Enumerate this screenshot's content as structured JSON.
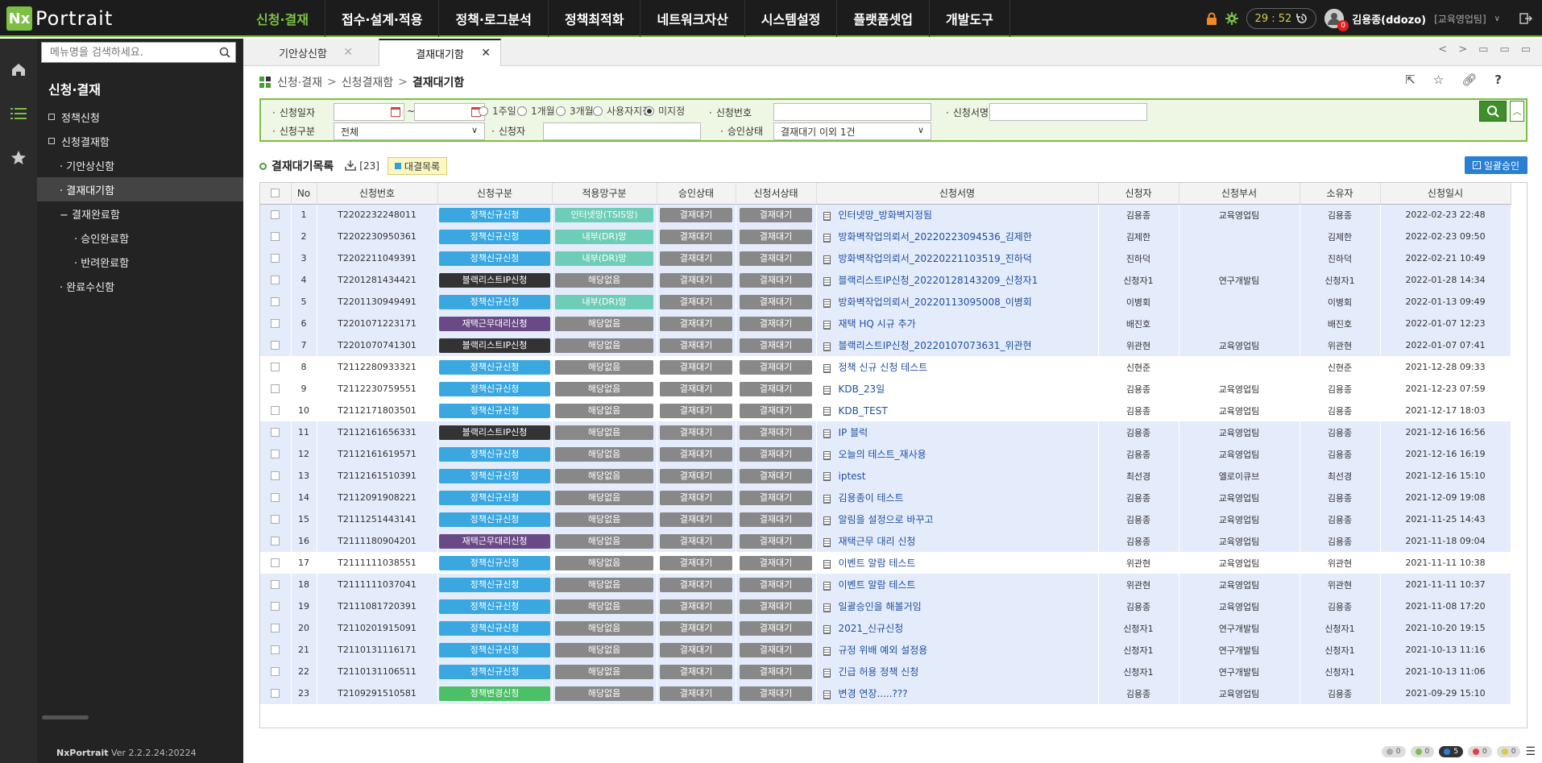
{
  "app": {
    "logo_mark": "Nx",
    "logo_text": "Portrait"
  },
  "nav": [
    {
      "label": "신청·결재",
      "active": true
    },
    {
      "label": "접수·설계·적용"
    },
    {
      "label": "정책·로그분석"
    },
    {
      "label": "정책최적화"
    },
    {
      "label": "네트워크자산"
    },
    {
      "label": "시스템설정"
    },
    {
      "label": "플랫폼셋업"
    },
    {
      "label": "개발도구"
    }
  ],
  "topright": {
    "timer": "29 : 52",
    "notif_count": "0",
    "user": "김용종(ddozo)",
    "dept": "[교육영업팀]"
  },
  "sidebar": {
    "search_placeholder": "메뉴명을 검색하세요.",
    "title": "신청·결재",
    "items": [
      {
        "label": "정책신청",
        "level": 1
      },
      {
        "label": "신청결재함",
        "level": 1
      },
      {
        "label": "· 기안상신함",
        "level": 2
      },
      {
        "label": "· 결재대기함",
        "level": 2,
        "active": true
      },
      {
        "label": "−  결재완료함",
        "level": 2
      },
      {
        "label": "· 승인완료함",
        "level": 3
      },
      {
        "label": "· 반려완료함",
        "level": 3
      },
      {
        "label": "· 완료수신함",
        "level": 2
      }
    ],
    "version_brand": "NxPortrait",
    "version": "Ver 2.2.2.24:20224"
  },
  "tabs": [
    {
      "label": "기안상신함"
    },
    {
      "label": "결재대기함",
      "active": true
    }
  ],
  "breadcrumb": {
    "root": "신청·결재",
    "mid": "신청결재함",
    "current": "결재대기함"
  },
  "filter": {
    "date_label": "신청일자",
    "date_sep": "~",
    "period_options": [
      "1주일",
      "1개월",
      "3개월",
      "사용자지정",
      "미지정"
    ],
    "period_selected": 4,
    "reqno_label": "신청번호",
    "docname_label": "신청서명",
    "type_label": "신청구분",
    "type_value": "전체",
    "requester_label": "신청자",
    "status_label": "승인상태",
    "status_value": "결재대기 이외 1건"
  },
  "list": {
    "title": "결재대기목록",
    "count": "[23]",
    "delegate_label": "대결목록",
    "bulk_label": "일괄승인"
  },
  "table": {
    "headers": [
      "No",
      "신청번호",
      "신청구분",
      "적용망구분",
      "승인상태",
      "신청서상태",
      "신청서명",
      "신청자",
      "신청부서",
      "소유자",
      "신청일시"
    ],
    "rows": [
      {
        "no": "1",
        "reqno": "T2202232248011",
        "type": "정책신규신청",
        "tc": "blue",
        "net": "인터넷망(TSIS망)",
        "nc": "teal",
        "ap": "결재대기",
        "st": "결재대기",
        "name": "인터넷망_방화벽지정됨",
        "req": "김용종",
        "dept": "교육영업팀",
        "owner": "김용종",
        "date": "2022-02-23 22:48",
        "hl": true
      },
      {
        "no": "2",
        "reqno": "T2202230950361",
        "type": "정책신규신청",
        "tc": "blue",
        "net": "내부(DR)망",
        "nc": "teal",
        "ap": "결재대기",
        "st": "결재대기",
        "name": "방화벽작업의뢰서_20220223094536_김제한",
        "req": "김제한",
        "dept": "",
        "owner": "김제한",
        "date": "2022-02-23 09:50",
        "hl": true
      },
      {
        "no": "3",
        "reqno": "T2202211049391",
        "type": "정책신규신청",
        "tc": "blue",
        "net": "내부(DR)망",
        "nc": "teal",
        "ap": "결재대기",
        "st": "결재대기",
        "name": "방화벽작업의뢰서_20220221103519_진하덕",
        "req": "진하덕",
        "dept": "",
        "owner": "진하덕",
        "date": "2022-02-21 10:49",
        "hl": true
      },
      {
        "no": "4",
        "reqno": "T2201281434421",
        "type": "블랙리스트IP신청",
        "tc": "dark",
        "net": "해당없음",
        "nc": "gray",
        "ap": "결재대기",
        "st": "결재대기",
        "name": "블랙리스트IP신청_20220128143209_신청자1",
        "req": "신청자1",
        "dept": "연구개발팀",
        "owner": "신청자1",
        "date": "2022-01-28 14:34",
        "hl": true
      },
      {
        "no": "5",
        "reqno": "T2201130949491",
        "type": "정책신규신청",
        "tc": "blue",
        "net": "내부(DR)망",
        "nc": "teal",
        "ap": "결재대기",
        "st": "결재대기",
        "name": "방화벽작업의뢰서_20220113095008_이병회",
        "req": "이병회",
        "dept": "",
        "owner": "이병회",
        "date": "2022-01-13 09:49",
        "hl": true
      },
      {
        "no": "6",
        "reqno": "T2201071223171",
        "type": "재택근무대리신청",
        "tc": "purple",
        "net": "해당없음",
        "nc": "gray",
        "ap": "결재대기",
        "st": "결재대기",
        "name": "재택 HQ 시규 추가",
        "req": "배진호",
        "dept": "",
        "owner": "배진호",
        "date": "2022-01-07 12:23",
        "hl": true
      },
      {
        "no": "7",
        "reqno": "T2201070741301",
        "type": "블랙리스트IP신청",
        "tc": "dark",
        "net": "해당없음",
        "nc": "gray",
        "ap": "결재대기",
        "st": "결재대기",
        "name": "블랙리스트IP신청_20220107073631_위관현",
        "req": "위관현",
        "dept": "교육영업팀",
        "owner": "위관현",
        "date": "2022-01-07 07:41",
        "hl": true
      },
      {
        "no": "8",
        "reqno": "T2112280933321",
        "type": "정책신규신청",
        "tc": "blue",
        "net": "해당없음",
        "nc": "gray",
        "ap": "결재대기",
        "st": "결재대기",
        "name": "정책 신규 신청 테스트",
        "req": "신현준",
        "dept": "",
        "owner": "신현준",
        "date": "2021-12-28 09:33",
        "hl": false
      },
      {
        "no": "9",
        "reqno": "T2112230759551",
        "type": "정책신규신청",
        "tc": "blue",
        "net": "해당없음",
        "nc": "gray",
        "ap": "결재대기",
        "st": "결재대기",
        "name": "KDB_23일",
        "req": "김용종",
        "dept": "교육영업팀",
        "owner": "김용종",
        "date": "2021-12-23 07:59",
        "hl": false
      },
      {
        "no": "10",
        "reqno": "T2112171803501",
        "type": "정책신규신청",
        "tc": "blue",
        "net": "해당없음",
        "nc": "gray",
        "ap": "결재대기",
        "st": "결재대기",
        "name": "KDB_TEST",
        "req": "김용종",
        "dept": "교육영업팀",
        "owner": "김용종",
        "date": "2021-12-17 18:03",
        "hl": false
      },
      {
        "no": "11",
        "reqno": "T2112161656331",
        "type": "블랙리스트IP신청",
        "tc": "dark",
        "net": "해당없음",
        "nc": "gray",
        "ap": "결재대기",
        "st": "결재대기",
        "name": "IP 블럭",
        "req": "김용종",
        "dept": "교육영업팀",
        "owner": "김용종",
        "date": "2021-12-16 16:56",
        "hl": true
      },
      {
        "no": "12",
        "reqno": "T2112161619571",
        "type": "정책신규신청",
        "tc": "blue",
        "net": "해당없음",
        "nc": "gray",
        "ap": "결재대기",
        "st": "결재대기",
        "name": "오늘의 테스트_재사용",
        "req": "김용종",
        "dept": "교육영업팀",
        "owner": "김용종",
        "date": "2021-12-16 16:19",
        "hl": true
      },
      {
        "no": "13",
        "reqno": "T2112161510391",
        "type": "정책신규신청",
        "tc": "blue",
        "net": "해당없음",
        "nc": "gray",
        "ap": "결재대기",
        "st": "결재대기",
        "name": "iptest",
        "req": "최선경",
        "dept": "엘로이큐브",
        "owner": "최선경",
        "date": "2021-12-16 15:10",
        "hl": true
      },
      {
        "no": "14",
        "reqno": "T2112091908221",
        "type": "정책신규신청",
        "tc": "blue",
        "net": "해당없음",
        "nc": "gray",
        "ap": "결재대기",
        "st": "결재대기",
        "name": "김용종이 테스트",
        "req": "김용종",
        "dept": "교육영업팀",
        "owner": "김용종",
        "date": "2021-12-09 19:08",
        "hl": true
      },
      {
        "no": "15",
        "reqno": "T2111251443141",
        "type": "정책신규신청",
        "tc": "blue",
        "net": "해당없음",
        "nc": "gray",
        "ap": "결재대기",
        "st": "결재대기",
        "name": "알림을 설정으로 바꾸고",
        "req": "김용종",
        "dept": "교육영업팀",
        "owner": "김용종",
        "date": "2021-11-25 14:43",
        "hl": true
      },
      {
        "no": "16",
        "reqno": "T2111180904201",
        "type": "재택근무대리신청",
        "tc": "purple",
        "net": "해당없음",
        "nc": "gray",
        "ap": "결재대기",
        "st": "결재대기",
        "name": "재택근무 대리 신청",
        "req": "김용종",
        "dept": "교육영업팀",
        "owner": "김용종",
        "date": "2021-11-18 09:04",
        "hl": true
      },
      {
        "no": "17",
        "reqno": "T2111111038551",
        "type": "정책신규신청",
        "tc": "blue",
        "net": "해당없음",
        "nc": "gray",
        "ap": "결재대기",
        "st": "결재대기",
        "name": "이벤트 알람 테스트",
        "req": "위관현",
        "dept": "교육영업팀",
        "owner": "위관현",
        "date": "2021-11-11 10:38",
        "hl": false
      },
      {
        "no": "18",
        "reqno": "T2111111037041",
        "type": "정책신규신청",
        "tc": "blue",
        "net": "해당없음",
        "nc": "gray",
        "ap": "결재대기",
        "st": "결재대기",
        "name": "이벤트 알람 테스트",
        "req": "위관현",
        "dept": "교육영업팀",
        "owner": "위관현",
        "date": "2021-11-11 10:37",
        "hl": true
      },
      {
        "no": "19",
        "reqno": "T2111081720391",
        "type": "정책신규신청",
        "tc": "blue",
        "net": "해당없음",
        "nc": "gray",
        "ap": "결재대기",
        "st": "결재대기",
        "name": "일괄승인을 해볼거임",
        "req": "김용종",
        "dept": "교육영업팀",
        "owner": "김용종",
        "date": "2021-11-08 17:20",
        "hl": true
      },
      {
        "no": "20",
        "reqno": "T2110201915091",
        "type": "정책신규신청",
        "tc": "blue",
        "net": "해당없음",
        "nc": "gray",
        "ap": "결재대기",
        "st": "결재대기",
        "name": "2021_신규신청",
        "req": "신청자1",
        "dept": "연구개발팀",
        "owner": "신청자1",
        "date": "2021-10-20 19:15",
        "hl": true
      },
      {
        "no": "21",
        "reqno": "T2110131116171",
        "type": "정책신규신청",
        "tc": "blue",
        "net": "해당없음",
        "nc": "gray",
        "ap": "결재대기",
        "st": "결재대기",
        "name": "규정 위배 예외 설정용",
        "req": "신청자1",
        "dept": "연구개발팀",
        "owner": "신청자1",
        "date": "2021-10-13 11:16",
        "hl": true
      },
      {
        "no": "22",
        "reqno": "T2110131106511",
        "type": "정책신규신청",
        "tc": "blue",
        "net": "해당없음",
        "nc": "gray",
        "ap": "결재대기",
        "st": "결재대기",
        "name": "긴급 허용 정책 신청",
        "req": "신청자1",
        "dept": "연구개발팀",
        "owner": "신청자1",
        "date": "2021-10-13 11:06",
        "hl": true
      },
      {
        "no": "23",
        "reqno": "T2109291510581",
        "type": "정책변경신청",
        "tc": "green",
        "net": "해당없음",
        "nc": "gray",
        "ap": "결재대기",
        "st": "결재대기",
        "name": "변경 연장.....???",
        "req": "김용종",
        "dept": "교육영업팀",
        "owner": "김용종",
        "date": "2021-09-29 15:10",
        "hl": true
      }
    ]
  },
  "statusbar": [
    {
      "count": "0",
      "color": "#aaaaaa"
    },
    {
      "count": "0",
      "color": "#7bc043"
    },
    {
      "count": "5",
      "color": "#2a7fd4",
      "dark": true
    },
    {
      "count": "0",
      "color": "#e04040"
    },
    {
      "count": "0",
      "color": "#d8c84a"
    }
  ],
  "colors": {
    "accent": "#7bc043",
    "blue": "#3aa7e0",
    "teal": "#6ecdb6",
    "dark": "#333333",
    "purple": "#6a4a86",
    "green": "#4cc067",
    "gray": "#888888",
    "highlight_row": "#e4ecfb"
  }
}
